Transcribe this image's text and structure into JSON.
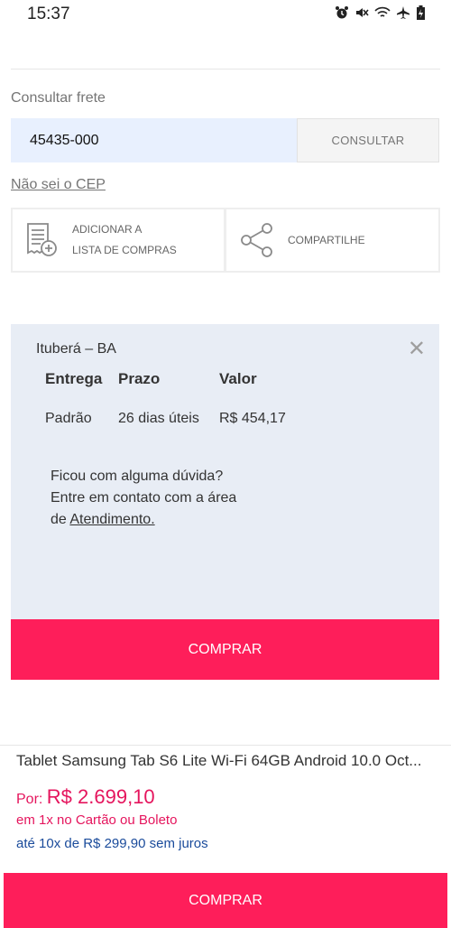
{
  "status_bar": {
    "time": "15:37"
  },
  "frete": {
    "label": "Consultar frete",
    "cep_value": "45435-000",
    "consult_button": "CONSULTAR",
    "unknown_cep_link": "Não sei o CEP"
  },
  "actions": {
    "shopping_list": {
      "line1": "ADICIONAR A",
      "line2": "LISTA DE COMPRAS",
      "icon": "shopping-list-add-icon"
    },
    "share": {
      "label": "COMPARTILHE",
      "icon": "share-icon"
    }
  },
  "shipping_result": {
    "location": "Ituberá – BA",
    "headers": {
      "delivery": "Entrega",
      "deadline": "Prazo",
      "value": "Valor"
    },
    "rows": [
      {
        "delivery": "Padrão",
        "deadline": "26 dias úteis",
        "value": "R$ 454,17"
      }
    ],
    "help": {
      "line1": "Ficou com alguma dúvida?",
      "line2": "Entre em contato com a área",
      "line3_prefix": "de ",
      "link": "Atendimento."
    },
    "buy_button": "COMPRAR"
  },
  "product": {
    "name": "Tablet Samsung Tab S6 Lite Wi-Fi 64GB Android 10.0 Oct...",
    "price_prefix": "Por:",
    "price": "R$ 2.699,10",
    "payment_method": "em 1x no Cartão ou Boleto",
    "installments": "até 10x de R$ 299,90 sem juros",
    "buy_button": "COMPRAR"
  },
  "colors": {
    "accent": "#fe1e5a",
    "price": "#e5155d",
    "installments": "#1a4b9b",
    "panel": "#e8edf5"
  }
}
